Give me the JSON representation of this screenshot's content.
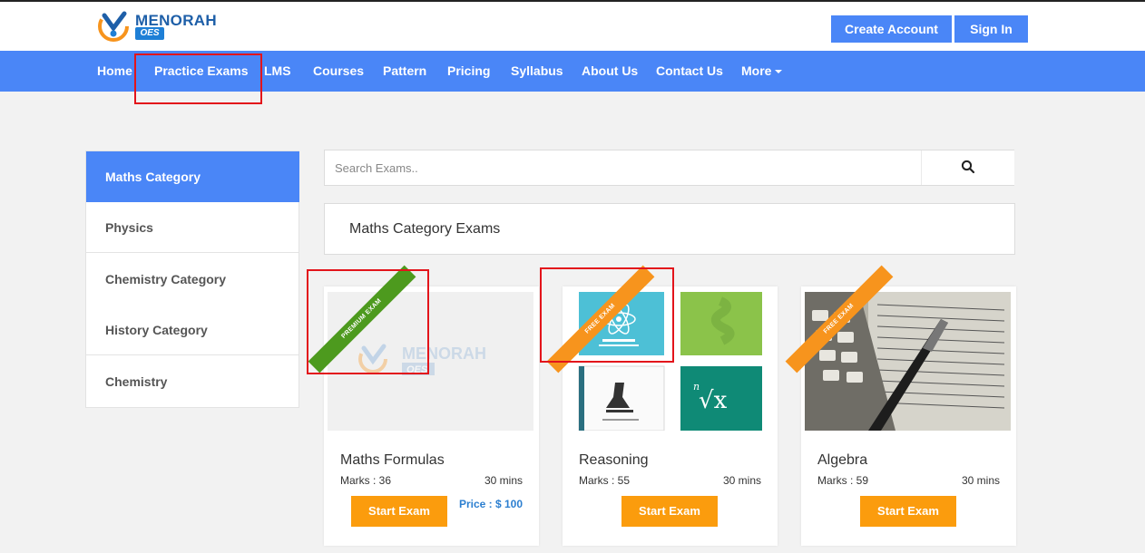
{
  "brand": {
    "name": "MENORAH",
    "sub": "OES"
  },
  "header": {
    "create_account": "Create Account",
    "sign_in": "Sign In"
  },
  "nav": {
    "home": "Home",
    "practice_exams": "Practice Exams",
    "lms": "LMS",
    "courses": "Courses",
    "pattern": "Pattern",
    "pricing": "Pricing",
    "syllabus": "Syllabus",
    "about": "About Us",
    "contact": "Contact Us",
    "more": "More"
  },
  "sidebar": {
    "items": [
      {
        "label": "Maths Category",
        "active": true
      },
      {
        "label": "Physics"
      },
      {
        "label": "Chemistry Category"
      },
      {
        "label": "History Category"
      },
      {
        "label": "Chemistry"
      }
    ]
  },
  "search": {
    "placeholder": "Search Exams..",
    "value": "",
    "icon": "search-icon"
  },
  "category_heading": "Maths Category Exams",
  "cards": [
    {
      "ribbon": "PREMIUM EXAM",
      "ribbon_color": "#4d9a1e",
      "thumb": "menorah-placeholder",
      "title": "Maths Formulas",
      "marks": "Marks : 36",
      "time": "30 mins",
      "button": "Start Exam",
      "price": "Price : $ 100"
    },
    {
      "ribbon": "FREE EXAM",
      "ribbon_color": "#f7941d",
      "thumb": "books",
      "title": "Reasoning",
      "marks": "Marks : 55",
      "time": "30 mins",
      "button": "Start Exam"
    },
    {
      "ribbon": "FREE EXAM",
      "ribbon_color": "#f7941d",
      "thumb": "calculator-photo",
      "title": "Algebra",
      "marks": "Marks : 59",
      "time": "30 mins",
      "button": "Start Exam"
    }
  ],
  "colors": {
    "primary": "#4a86f7",
    "accent": "#fb9c0d",
    "highlight": "#e3141b",
    "price": "#2c7fd0"
  }
}
